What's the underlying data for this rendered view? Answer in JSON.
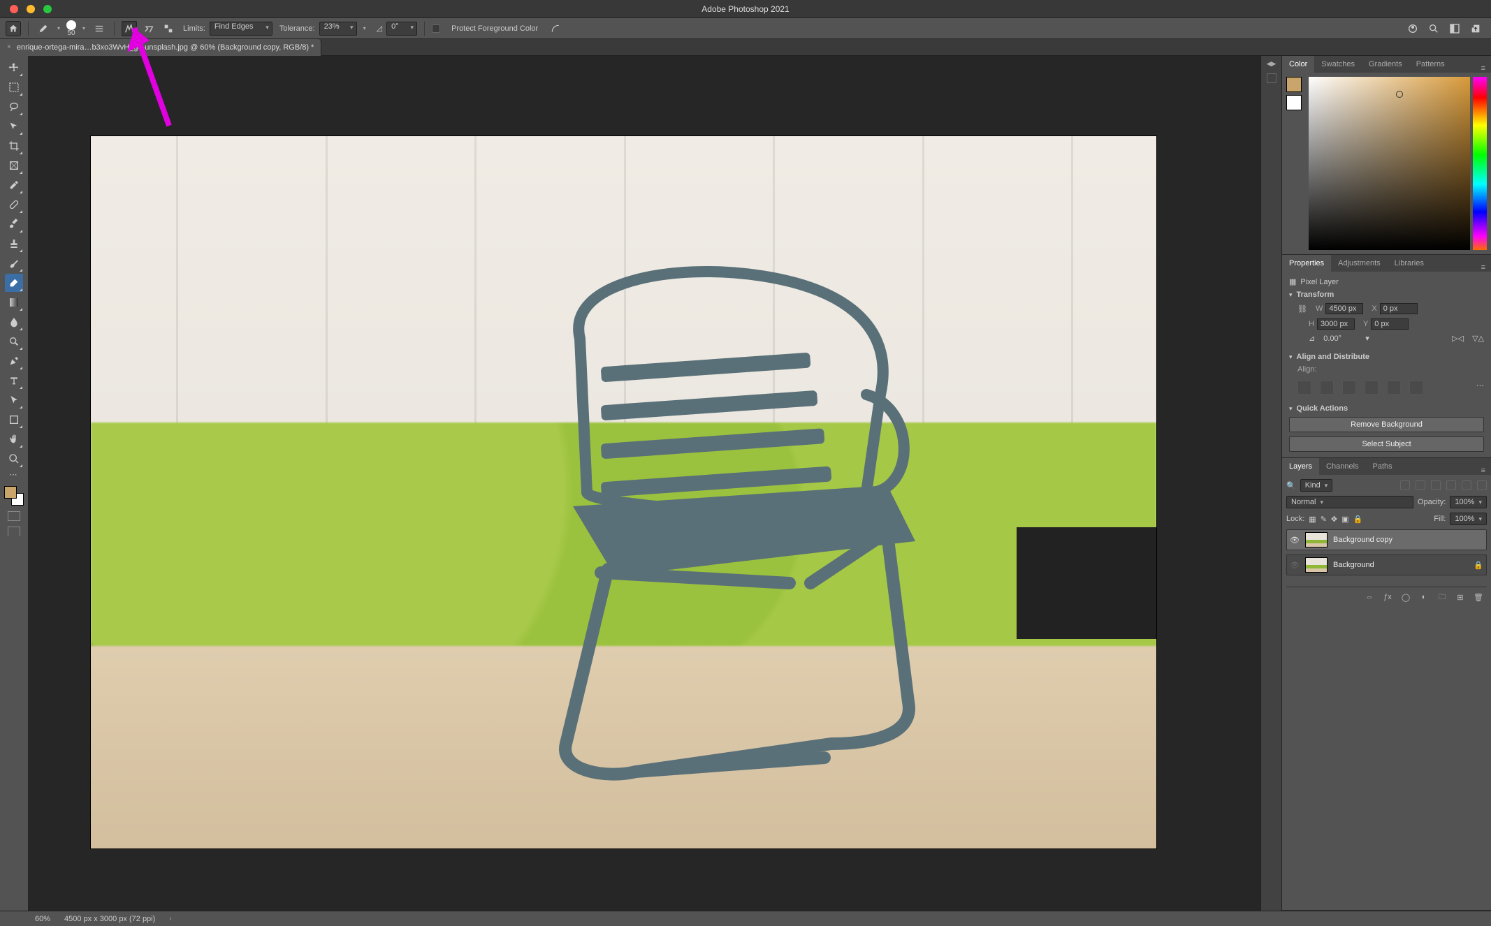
{
  "app": {
    "title": "Adobe Photoshop 2021"
  },
  "options": {
    "brush_size": "50",
    "limits_label": "Limits:",
    "limits_value": "Find Edges",
    "tolerance_label": "Tolerance:",
    "tolerance_value": "23%",
    "angle_value": "0°",
    "protect_label": "Protect Foreground Color"
  },
  "document": {
    "tab_name": "enrique-ortega-mira…b3xo3WvH_g8-unsplash.jpg @ 60% (Background copy, RGB/8) *"
  },
  "color_panel": {
    "tabs": [
      "Color",
      "Swatches",
      "Gradients",
      "Patterns"
    ]
  },
  "properties_panel": {
    "tabs": [
      "Properties",
      "Adjustments",
      "Libraries"
    ],
    "layer_type": "Pixel Layer",
    "transform_label": "Transform",
    "w_label": "W",
    "w_val": "4500 px",
    "h_label": "H",
    "h_val": "3000 px",
    "x_label": "X",
    "x_val": "0 px",
    "y_label": "Y",
    "y_val": "0 px",
    "angle": "0.00°",
    "align_label": "Align and Distribute",
    "align_sub": "Align:",
    "quick_label": "Quick Actions",
    "remove_bg": "Remove Background",
    "select_subject": "Select Subject"
  },
  "layers_panel": {
    "tabs": [
      "Layers",
      "Channels",
      "Paths"
    ],
    "kind": "Kind",
    "blend": "Normal",
    "opacity_label": "Opacity:",
    "opacity": "100%",
    "lock_label": "Lock:",
    "fill_label": "Fill:",
    "fill": "100%",
    "items": [
      {
        "name": "Background copy",
        "visible": true,
        "locked": false
      },
      {
        "name": "Background",
        "visible": false,
        "locked": true
      }
    ]
  },
  "status": {
    "zoom": "60%",
    "dims": "4500 px x 3000 px (72 ppi)"
  }
}
